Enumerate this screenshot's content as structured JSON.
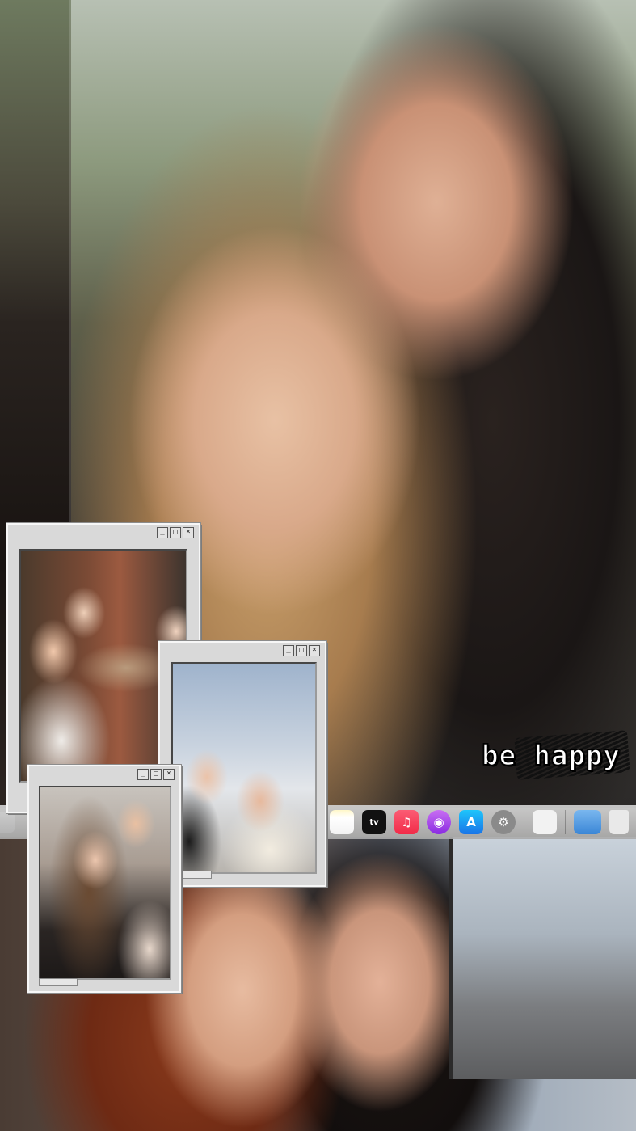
{
  "caption": {
    "text": "be happy"
  },
  "dock": {
    "icons": [
      {
        "name": "notes-icon",
        "glyph": ""
      },
      {
        "name": "apple-tv-icon",
        "glyph": "tv"
      },
      {
        "name": "music-icon",
        "glyph": "♫"
      },
      {
        "name": "podcasts-icon",
        "glyph": "◉"
      },
      {
        "name": "app-store-icon",
        "glyph": "A"
      },
      {
        "name": "system-settings-icon",
        "glyph": "⚙"
      },
      {
        "name": "blank-app-icon",
        "glyph": ""
      },
      {
        "name": "finder-window-icon",
        "glyph": ""
      },
      {
        "name": "trash-icon",
        "glyph": ""
      }
    ]
  },
  "windows": {
    "controls": {
      "minimize": "_",
      "maximize": "□",
      "close": "×"
    }
  }
}
